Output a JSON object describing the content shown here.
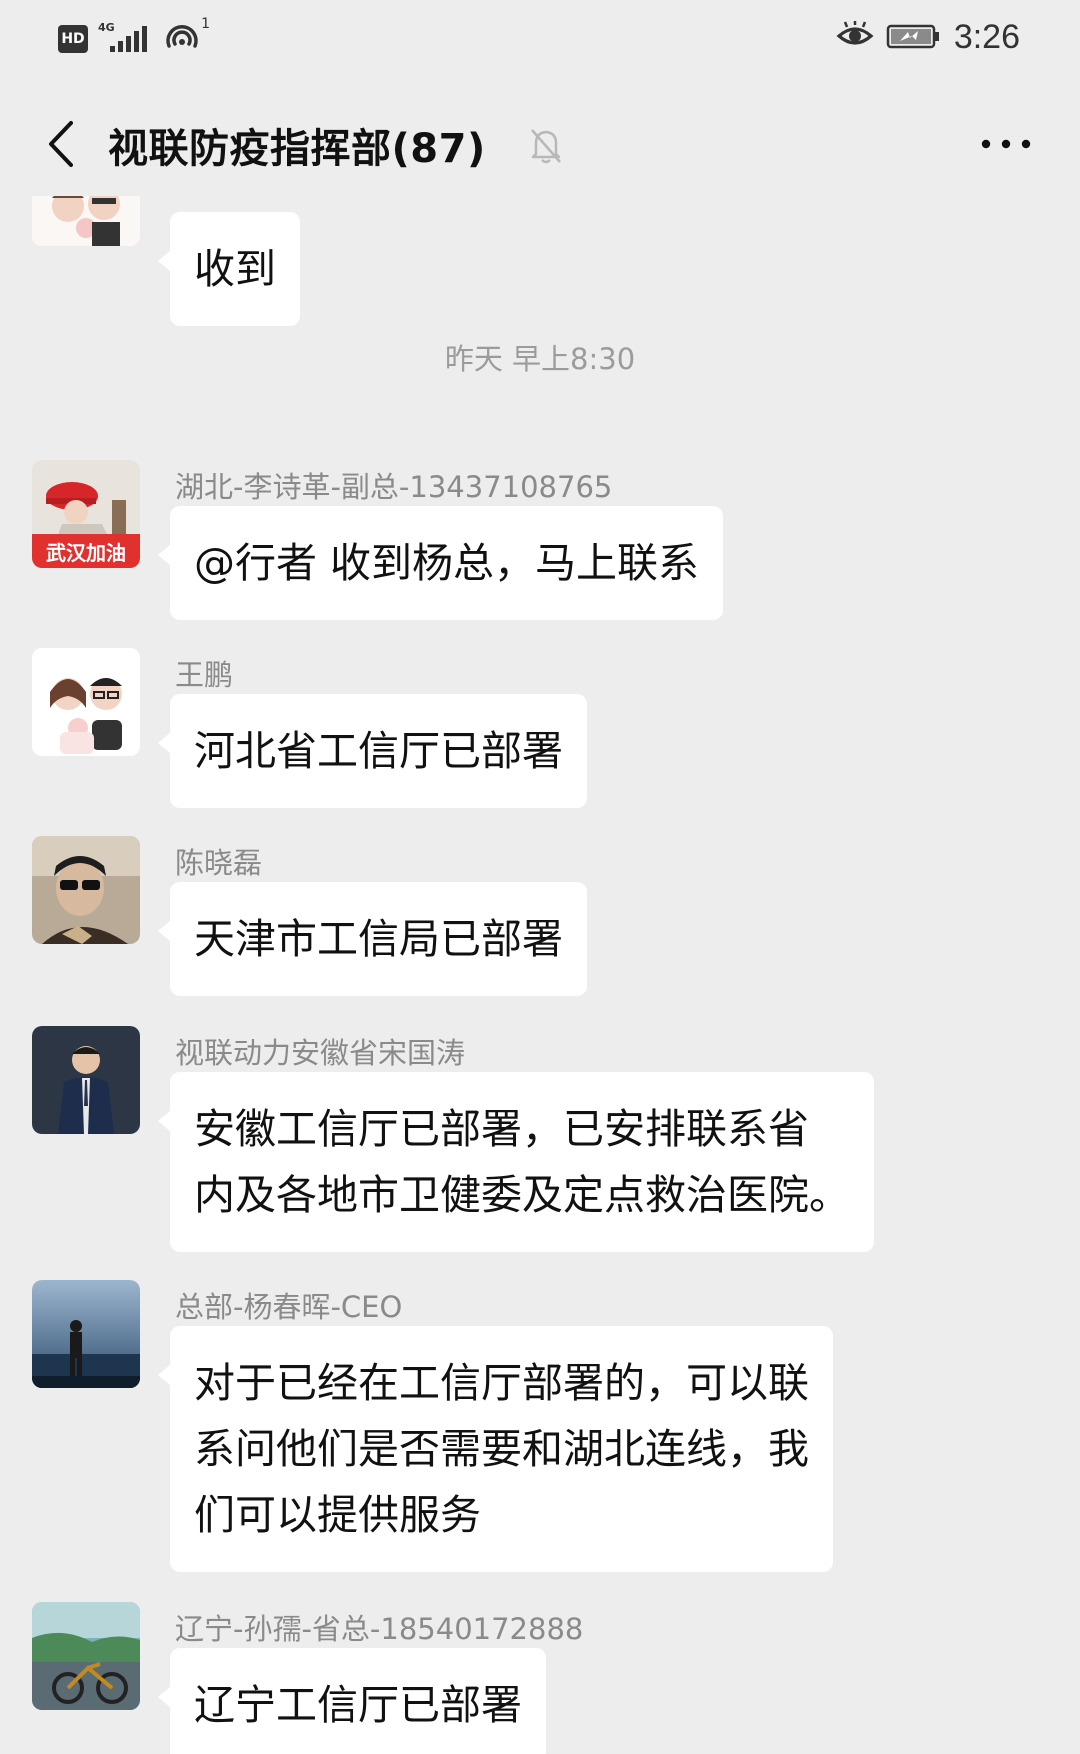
{
  "status_bar": {
    "hd": "HD",
    "network": "4G",
    "wifi_sup": "1",
    "time": "3:26",
    "icons": [
      "eye-comfort-icon",
      "battery-charging-icon",
      "signal-icon",
      "hotspot-icon"
    ]
  },
  "header": {
    "title": "视联防疫指挥部(87)",
    "muted": true
  },
  "timestamp": "昨天 早上8:30",
  "messages": [
    {
      "sender": "",
      "lines": [
        "收到"
      ]
    },
    {
      "sender": "湖北-李诗革-副总-13437108765",
      "avatar_badge": "武汉加油",
      "lines": [
        "@行者  收到杨总，马上联系"
      ]
    },
    {
      "sender": "王鹏",
      "lines": [
        "河北省工信厅已部署"
      ]
    },
    {
      "sender": "陈晓磊",
      "lines": [
        "天津市工信局已部署"
      ]
    },
    {
      "sender": "视联动力安徽省宋国涛",
      "lines": [
        "安徽工信厅已部署，已安排联系省",
        "内及各地市卫健委及定点救治医院。"
      ]
    },
    {
      "sender": "总部-杨春晖-CEO",
      "lines": [
        "对于已经在工信厅部署的，可以联",
        "系问他们是否需要和湖北连线，我",
        "们可以提供服务"
      ]
    },
    {
      "sender": "辽宁-孙孺-省总-18540172888",
      "lines": [
        "辽宁工信厅已部署"
      ]
    }
  ],
  "colors": {
    "background": "#ededed",
    "bubble": "#ffffff",
    "name_text": "#8a8a8a",
    "badge_red": "#e0312f"
  }
}
